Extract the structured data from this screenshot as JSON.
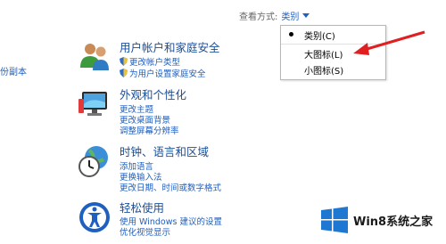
{
  "left_fragment": "份副本",
  "view_by": {
    "label": "查看方式:",
    "value": "类别"
  },
  "dropdown": {
    "items": [
      {
        "label": "类别(C)",
        "selected": true
      },
      {
        "label": "大图标(L)",
        "selected": false
      },
      {
        "label": "小图标(S)",
        "selected": false
      }
    ]
  },
  "sections": [
    {
      "title": "用户帐户和家庭安全",
      "links": [
        "更改帐户类型",
        "为用户设置家庭安全"
      ]
    },
    {
      "title": "外观和个性化",
      "links": [
        "更改主题",
        "更改桌面背景",
        "调整屏幕分辨率"
      ]
    },
    {
      "title": "时钟、语言和区域",
      "links": [
        "添加语言",
        "更换输入法",
        "更改日期、时间或数字格式"
      ]
    },
    {
      "title": "轻松使用",
      "links": [
        "使用 Windows 建议的设置",
        "优化视觉显示"
      ]
    }
  ],
  "watermark": {
    "text": "Win8系统之家"
  },
  "colors": {
    "link": "#1f5fbf",
    "title": "#1a4e9a",
    "arrow": "#e02020",
    "win_logo": "#1e78d2"
  }
}
